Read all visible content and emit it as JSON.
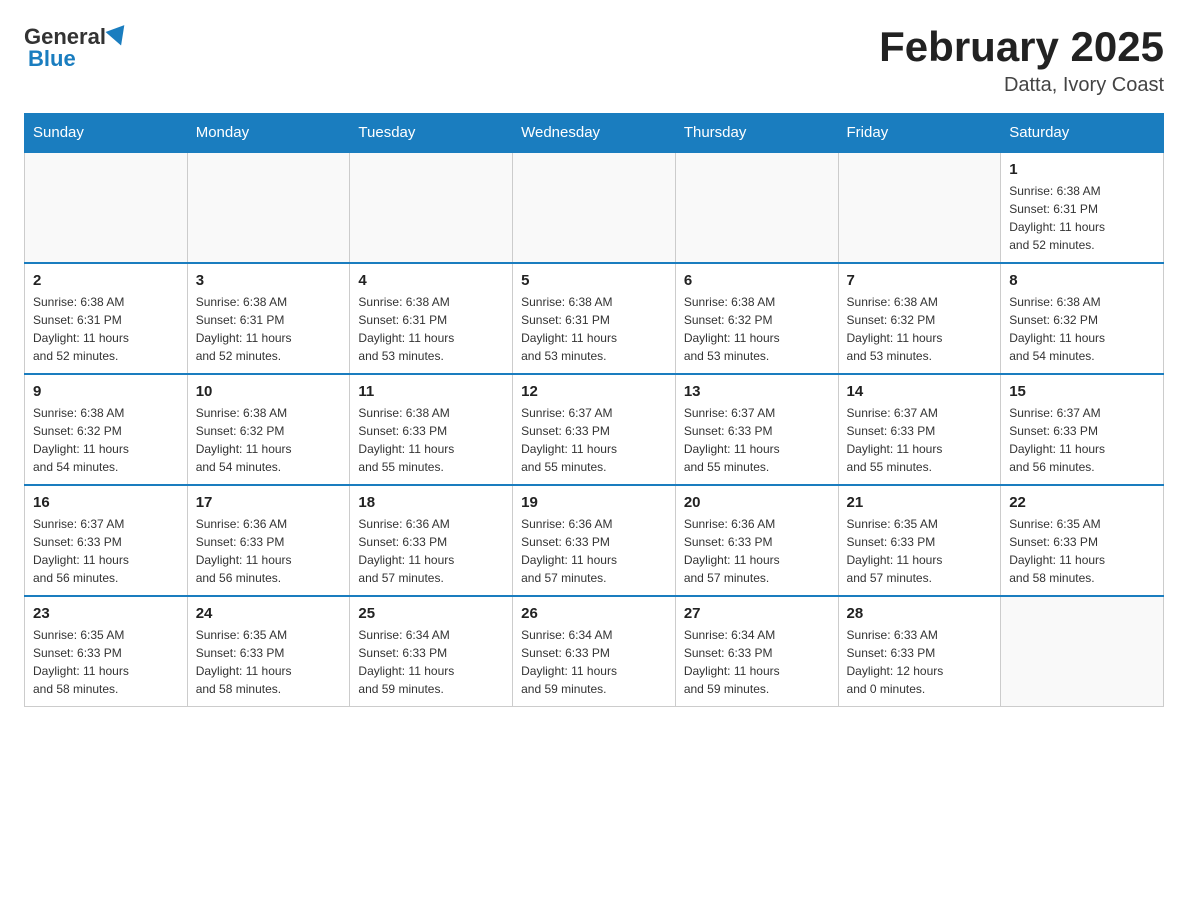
{
  "header": {
    "logo_general": "General",
    "logo_blue": "Blue",
    "title": "February 2025",
    "location": "Datta, Ivory Coast"
  },
  "days_of_week": [
    "Sunday",
    "Monday",
    "Tuesday",
    "Wednesday",
    "Thursday",
    "Friday",
    "Saturday"
  ],
  "weeks": [
    [
      {
        "day": "",
        "info": ""
      },
      {
        "day": "",
        "info": ""
      },
      {
        "day": "",
        "info": ""
      },
      {
        "day": "",
        "info": ""
      },
      {
        "day": "",
        "info": ""
      },
      {
        "day": "",
        "info": ""
      },
      {
        "day": "1",
        "info": "Sunrise: 6:38 AM\nSunset: 6:31 PM\nDaylight: 11 hours\nand 52 minutes."
      }
    ],
    [
      {
        "day": "2",
        "info": "Sunrise: 6:38 AM\nSunset: 6:31 PM\nDaylight: 11 hours\nand 52 minutes."
      },
      {
        "day": "3",
        "info": "Sunrise: 6:38 AM\nSunset: 6:31 PM\nDaylight: 11 hours\nand 52 minutes."
      },
      {
        "day": "4",
        "info": "Sunrise: 6:38 AM\nSunset: 6:31 PM\nDaylight: 11 hours\nand 53 minutes."
      },
      {
        "day": "5",
        "info": "Sunrise: 6:38 AM\nSunset: 6:31 PM\nDaylight: 11 hours\nand 53 minutes."
      },
      {
        "day": "6",
        "info": "Sunrise: 6:38 AM\nSunset: 6:32 PM\nDaylight: 11 hours\nand 53 minutes."
      },
      {
        "day": "7",
        "info": "Sunrise: 6:38 AM\nSunset: 6:32 PM\nDaylight: 11 hours\nand 53 minutes."
      },
      {
        "day": "8",
        "info": "Sunrise: 6:38 AM\nSunset: 6:32 PM\nDaylight: 11 hours\nand 54 minutes."
      }
    ],
    [
      {
        "day": "9",
        "info": "Sunrise: 6:38 AM\nSunset: 6:32 PM\nDaylight: 11 hours\nand 54 minutes."
      },
      {
        "day": "10",
        "info": "Sunrise: 6:38 AM\nSunset: 6:32 PM\nDaylight: 11 hours\nand 54 minutes."
      },
      {
        "day": "11",
        "info": "Sunrise: 6:38 AM\nSunset: 6:33 PM\nDaylight: 11 hours\nand 55 minutes."
      },
      {
        "day": "12",
        "info": "Sunrise: 6:37 AM\nSunset: 6:33 PM\nDaylight: 11 hours\nand 55 minutes."
      },
      {
        "day": "13",
        "info": "Sunrise: 6:37 AM\nSunset: 6:33 PM\nDaylight: 11 hours\nand 55 minutes."
      },
      {
        "day": "14",
        "info": "Sunrise: 6:37 AM\nSunset: 6:33 PM\nDaylight: 11 hours\nand 55 minutes."
      },
      {
        "day": "15",
        "info": "Sunrise: 6:37 AM\nSunset: 6:33 PM\nDaylight: 11 hours\nand 56 minutes."
      }
    ],
    [
      {
        "day": "16",
        "info": "Sunrise: 6:37 AM\nSunset: 6:33 PM\nDaylight: 11 hours\nand 56 minutes."
      },
      {
        "day": "17",
        "info": "Sunrise: 6:36 AM\nSunset: 6:33 PM\nDaylight: 11 hours\nand 56 minutes."
      },
      {
        "day": "18",
        "info": "Sunrise: 6:36 AM\nSunset: 6:33 PM\nDaylight: 11 hours\nand 57 minutes."
      },
      {
        "day": "19",
        "info": "Sunrise: 6:36 AM\nSunset: 6:33 PM\nDaylight: 11 hours\nand 57 minutes."
      },
      {
        "day": "20",
        "info": "Sunrise: 6:36 AM\nSunset: 6:33 PM\nDaylight: 11 hours\nand 57 minutes."
      },
      {
        "day": "21",
        "info": "Sunrise: 6:35 AM\nSunset: 6:33 PM\nDaylight: 11 hours\nand 57 minutes."
      },
      {
        "day": "22",
        "info": "Sunrise: 6:35 AM\nSunset: 6:33 PM\nDaylight: 11 hours\nand 58 minutes."
      }
    ],
    [
      {
        "day": "23",
        "info": "Sunrise: 6:35 AM\nSunset: 6:33 PM\nDaylight: 11 hours\nand 58 minutes."
      },
      {
        "day": "24",
        "info": "Sunrise: 6:35 AM\nSunset: 6:33 PM\nDaylight: 11 hours\nand 58 minutes."
      },
      {
        "day": "25",
        "info": "Sunrise: 6:34 AM\nSunset: 6:33 PM\nDaylight: 11 hours\nand 59 minutes."
      },
      {
        "day": "26",
        "info": "Sunrise: 6:34 AM\nSunset: 6:33 PM\nDaylight: 11 hours\nand 59 minutes."
      },
      {
        "day": "27",
        "info": "Sunrise: 6:34 AM\nSunset: 6:33 PM\nDaylight: 11 hours\nand 59 minutes."
      },
      {
        "day": "28",
        "info": "Sunrise: 6:33 AM\nSunset: 6:33 PM\nDaylight: 12 hours\nand 0 minutes."
      },
      {
        "day": "",
        "info": ""
      }
    ]
  ]
}
